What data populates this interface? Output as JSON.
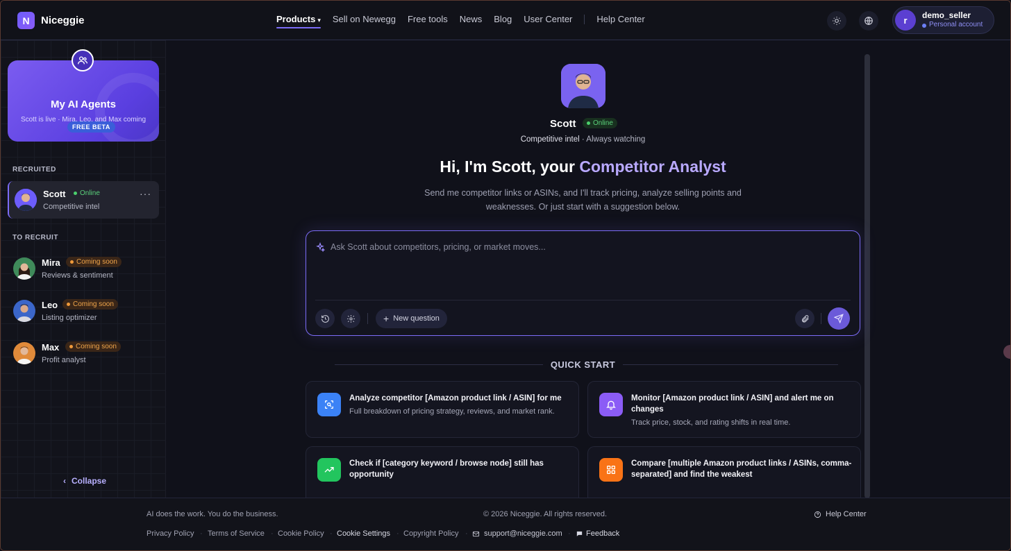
{
  "brand": {
    "logo_letter": "N",
    "name": "Niceggie"
  },
  "nav": {
    "items": [
      "Products",
      "Sell on Newegg",
      "Free tools",
      "News",
      "Blog",
      "User Center",
      "Help Center"
    ],
    "active": "Products",
    "caret": "▾"
  },
  "account": {
    "initial": "r",
    "name": "demo_seller",
    "type": "Personal account"
  },
  "sidebar": {
    "card": {
      "title": "My AI Agents",
      "subtitle": "Scott is live · Mira, Leo, and Max coming soon",
      "badge": "FREE BETA"
    },
    "recruited_label": "RECRUITED",
    "recruited": [
      {
        "name": "Scott",
        "status": "Online",
        "desc": "Competitive intel",
        "more": "···"
      }
    ],
    "to_recruit_label": "TO RECRUIT",
    "to_recruit": [
      {
        "name": "Mira",
        "status": "Coming soon",
        "desc": "Reviews & sentiment"
      },
      {
        "name": "Leo",
        "status": "Coming soon",
        "desc": "Listing optimizer"
      },
      {
        "name": "Max",
        "status": "Coming soon",
        "desc": "Profit analyst"
      }
    ],
    "collapse": "Collapse",
    "collapse_chevron": "‹"
  },
  "hero": {
    "name": "Scott",
    "status": "Online",
    "role": "Competitive intel",
    "role_suffix": " · Always watching",
    "headline_a": "Hi, I'm Scott, your ",
    "headline_b": "Competitor Analyst",
    "intro": "Send me competitor links or ASINs, and I'll track pricing, analyze selling points and weaknesses. Or just start with a suggestion below."
  },
  "composer": {
    "placeholder": "Ask Scott about competitors, pricing, or market moves...",
    "new_question": "New question",
    "plus": "+"
  },
  "quick_start": {
    "title": "QUICK START",
    "cards": [
      {
        "title": "Analyze competitor [Amazon product link / ASIN] for me",
        "desc": "Full breakdown of pricing strategy, reviews, and market rank.",
        "color": "#3b82f6",
        "icon": "scan-icon"
      },
      {
        "title": "Monitor [Amazon product link / ASIN] and alert me on changes",
        "desc": "Track price, stock, and rating shifts in real time.",
        "color": "#8b5cf6",
        "icon": "bell-icon"
      },
      {
        "title": "Check if [category keyword / browse node] still has opportunity",
        "desc": "",
        "color": "#22c55e",
        "icon": "trend-icon"
      },
      {
        "title": "Compare [multiple Amazon product links / ASINs, comma-separated] and find the weakest",
        "desc": "",
        "color": "#f97316",
        "icon": "grid-icon"
      }
    ]
  },
  "footer": {
    "tagline": "AI does the work. You do the business.",
    "copyright": "© 2026 Niceggie. All rights reserved.",
    "help": "Help Center",
    "links": [
      "Privacy Policy",
      "Terms of Service",
      "Cookie Policy",
      "Cookie Settings",
      "Copyright Policy"
    ],
    "email": "support@niceggie.com",
    "feedback": "Feedback",
    "separator": "·"
  }
}
